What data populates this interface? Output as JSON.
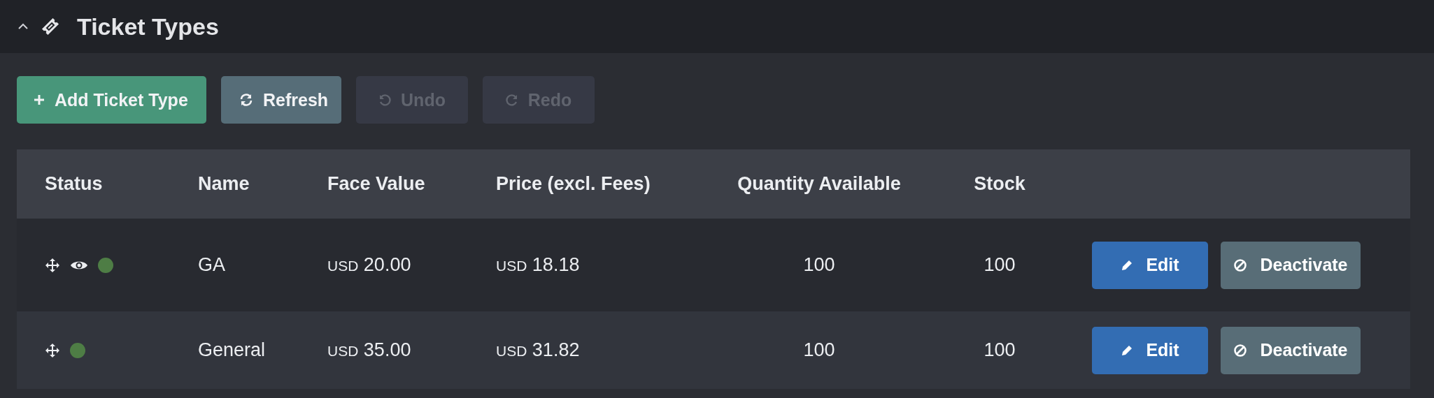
{
  "panel": {
    "title": "Ticket Types",
    "expanded": true
  },
  "toolbar": [
    {
      "kind": "add",
      "label": "Add Ticket Type",
      "disabled": false
    },
    {
      "kind": "refresh",
      "label": "Refresh",
      "disabled": false
    },
    {
      "kind": "undo",
      "label": "Undo",
      "disabled": true
    },
    {
      "kind": "redo",
      "label": "Redo",
      "disabled": true
    }
  ],
  "table": {
    "columns": [
      "Status",
      "Name",
      "Face Value",
      "Price (excl. Fees)",
      "Quantity Available",
      "Stock"
    ],
    "rows": [
      {
        "visible": true,
        "color": "#4e7d45",
        "name": "GA",
        "face_value": {
          "currency": "USD",
          "amount": "20.00"
        },
        "price": {
          "currency": "USD",
          "amount": "18.18"
        },
        "quantity": "100",
        "stock": "100",
        "actions": [
          "Edit",
          "Deactivate"
        ]
      },
      {
        "visible": false,
        "color": "#4e7d45",
        "name": "General",
        "face_value": {
          "currency": "USD",
          "amount": "35.00"
        },
        "price": {
          "currency": "USD",
          "amount": "31.82"
        },
        "quantity": "100",
        "stock": "100",
        "actions": [
          "Edit",
          "Deactivate"
        ]
      }
    ]
  }
}
